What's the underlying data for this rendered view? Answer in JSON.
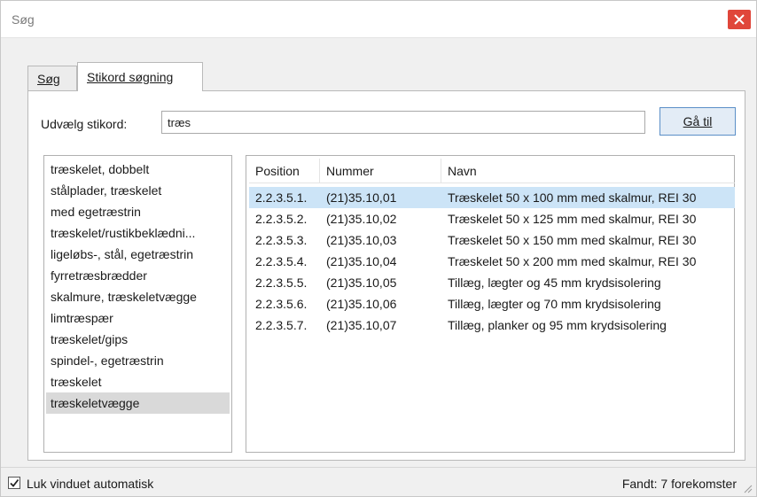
{
  "window": {
    "title": "Søg",
    "close_icon": "close-icon",
    "colors": {
      "close_button": "#e0463a",
      "selected_row": "#cce4f7",
      "button_border": "#5b8fc7"
    }
  },
  "tabs": [
    {
      "label": "Søg",
      "active": false
    },
    {
      "label": "Stikord søgning",
      "active": true
    }
  ],
  "filter": {
    "label": "Udvælg stikord:",
    "value": "træs",
    "button_label": "Gå til"
  },
  "keywords": [
    "træskelet, dobbelt",
    "stålplader, træskelet",
    "med egetræstrin",
    "træskelet/rustikbeklædni...",
    "ligeløbs-, stål, egetræstrin",
    "fyrretræsbrædder",
    "skalmure, træskeletvægge",
    "limtræspær",
    "træskelet/gips",
    "spindel-, egetræstrin",
    "træskelet",
    "træskeletvægge"
  ],
  "selected_keyword_index": 11,
  "results": {
    "columns": [
      "Position",
      "Nummer",
      "Navn"
    ],
    "rows": [
      [
        "2.2.3.5.1.",
        "(21)35.10,01",
        "Træskelet 50 x 100 mm med skalmur, REI 30"
      ],
      [
        "2.2.3.5.2.",
        "(21)35.10,02",
        "Træskelet 50 x 125 mm med skalmur, REI 30"
      ],
      [
        "2.2.3.5.3.",
        "(21)35.10,03",
        "Træskelet 50 x 150 mm med skalmur, REI 30"
      ],
      [
        "2.2.3.5.4.",
        "(21)35.10,04",
        "Træskelet 50 x 200 mm med skalmur, REI 30"
      ],
      [
        "2.2.3.5.5.",
        "(21)35.10,05",
        "Tillæg, lægter og 45 mm krydsisolering"
      ],
      [
        "2.2.3.5.6.",
        "(21)35.10,06",
        "Tillæg, lægter og 70 mm krydsisolering"
      ],
      [
        "2.2.3.5.7.",
        "(21)35.10,07",
        "Tillæg, planker og 95 mm krydsisolering"
      ]
    ],
    "selected_row_index": 0
  },
  "status": {
    "auto_close_label": "Luk vinduet automatisk",
    "auto_close_checked": true,
    "found_text": "Fandt: 7 forekomster",
    "resize_icon": "resize-grip-icon"
  }
}
